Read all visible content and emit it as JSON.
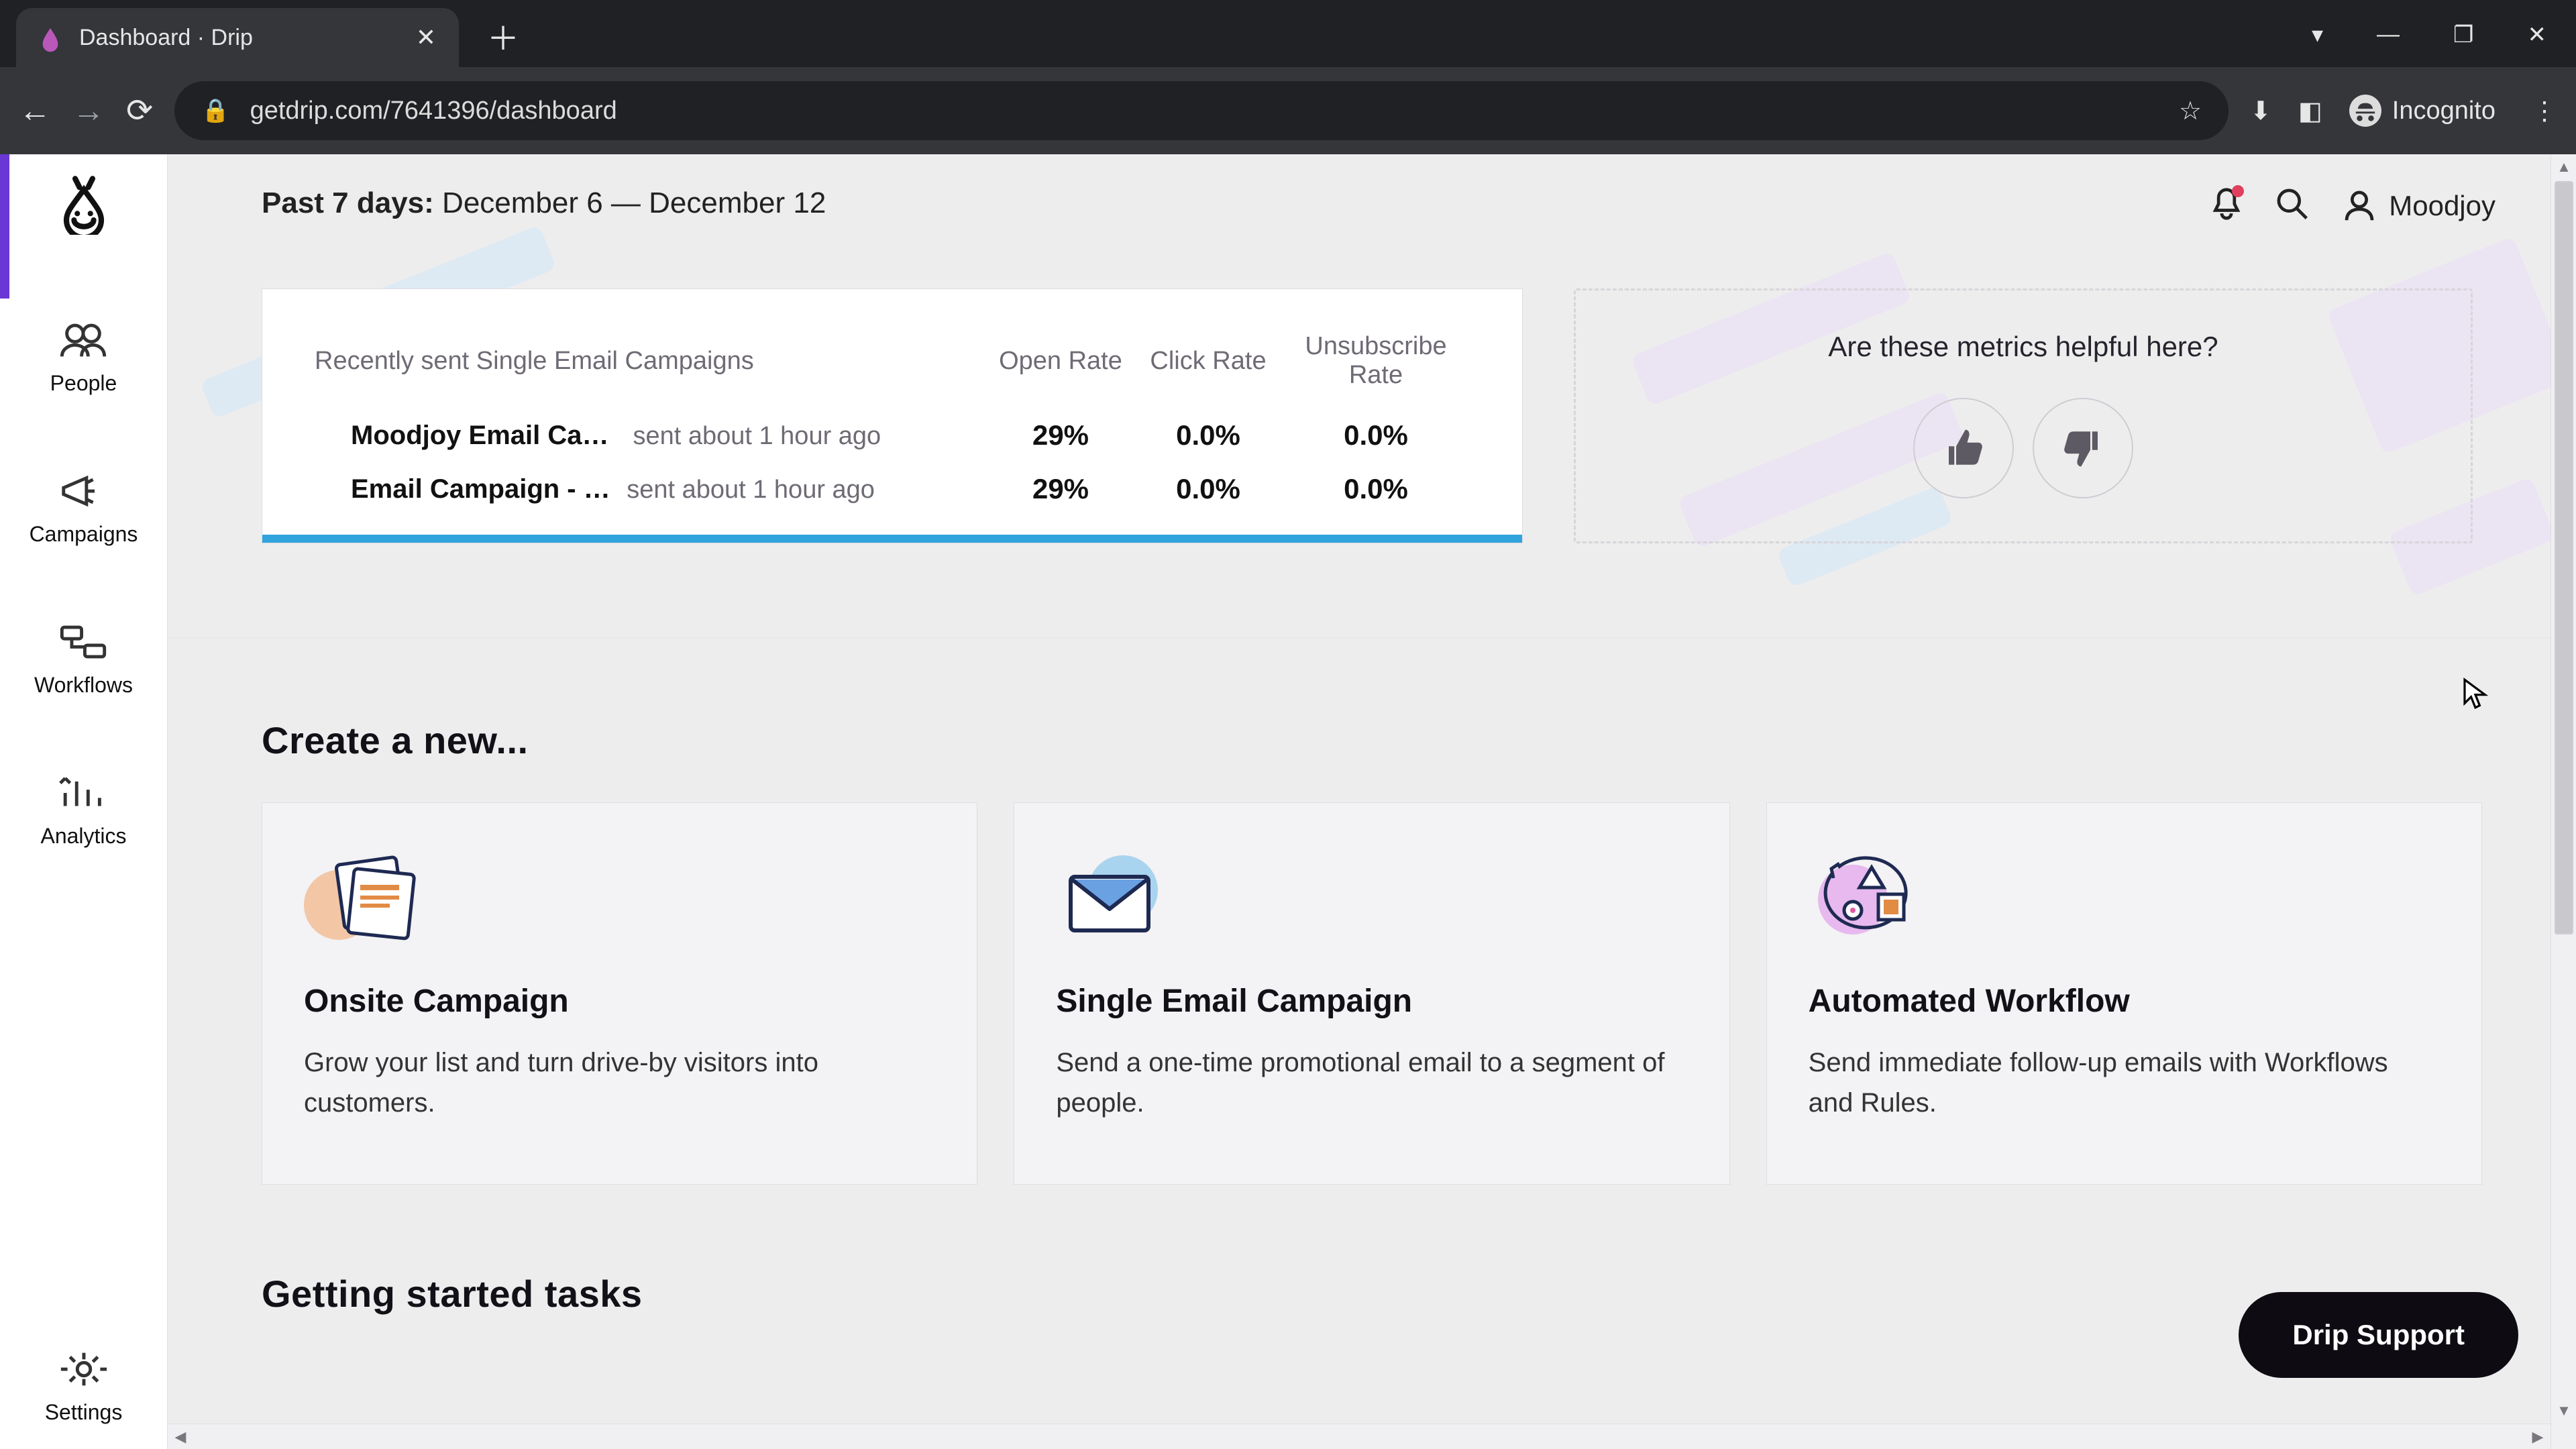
{
  "browser": {
    "tab_title": "Dashboard · Drip",
    "url": "getdrip.com/7641396/dashboard",
    "incognito_label": "Incognito"
  },
  "sidebar": {
    "items": [
      {
        "label": "People"
      },
      {
        "label": "Campaigns"
      },
      {
        "label": "Workflows"
      },
      {
        "label": "Analytics"
      },
      {
        "label": "Settings"
      }
    ]
  },
  "header": {
    "range_prefix": "Past 7 days:",
    "range_value": "December 6 — December 12",
    "username": "Moodjoy"
  },
  "campaigns": {
    "title": "Recently sent Single Email Campaigns",
    "cols": {
      "open": "Open Rate",
      "click": "Click Rate",
      "unsub": "Unsubscribe Rate"
    },
    "rows": [
      {
        "name": "Moodjoy Email Cam…",
        "when": "sent about 1 hour ago",
        "open": "29%",
        "click": "0.0%",
        "unsub": "0.0%"
      },
      {
        "name": "Email Campaign - …",
        "when": "sent about 1 hour ago",
        "open": "29%",
        "click": "0.0%",
        "unsub": "0.0%"
      }
    ]
  },
  "feedback": {
    "question": "Are these metrics helpful here?"
  },
  "create": {
    "heading": "Create a new...",
    "cards": [
      {
        "title": "Onsite Campaign",
        "desc": "Grow your list and turn drive-by visitors into customers."
      },
      {
        "title": "Single Email Campaign",
        "desc": "Send a one-time promotional email to a segment of people."
      },
      {
        "title": "Automated Workflow",
        "desc": "Send immediate follow-up emails with Workflows and Rules."
      }
    ]
  },
  "getting_started": {
    "heading": "Getting started tasks"
  },
  "support": {
    "label": "Drip Support"
  },
  "colors": {
    "accent": "#6a37d6",
    "progress": "#31a3dd",
    "notif": "#e0405d"
  }
}
